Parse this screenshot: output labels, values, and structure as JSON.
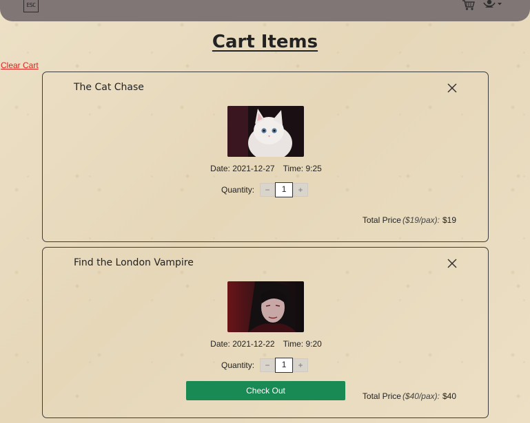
{
  "nav": {
    "logo_text": "ESC",
    "icons": [
      "cart-icon",
      "user-account-icon",
      "caret-down-icon"
    ]
  },
  "page": {
    "title": "Cart Items",
    "clear_cart": "Clear Cart"
  },
  "labels": {
    "date": "Date:",
    "time": "Time:",
    "quantity": "Quantity:",
    "total_price": "Total Price",
    "minus": "−",
    "plus": "+",
    "checkout": "Check Out"
  },
  "items": [
    {
      "name": "The Cat Chase",
      "image": "white-kitten",
      "date": "2021-12-27",
      "time": "9:25",
      "quantity": "1",
      "per_pax": "($19/pax):",
      "total": "$19"
    },
    {
      "name": "Find the London Vampire",
      "image": "vampire-portrait",
      "date": "2021-12-22",
      "time": "9:20",
      "quantity": "1",
      "per_pax": "($40/pax):",
      "total": "$40"
    }
  ],
  "colors": {
    "navbar": "#7f7675",
    "link_red": "#e0201a",
    "checkout_green": "#1a8a54"
  }
}
